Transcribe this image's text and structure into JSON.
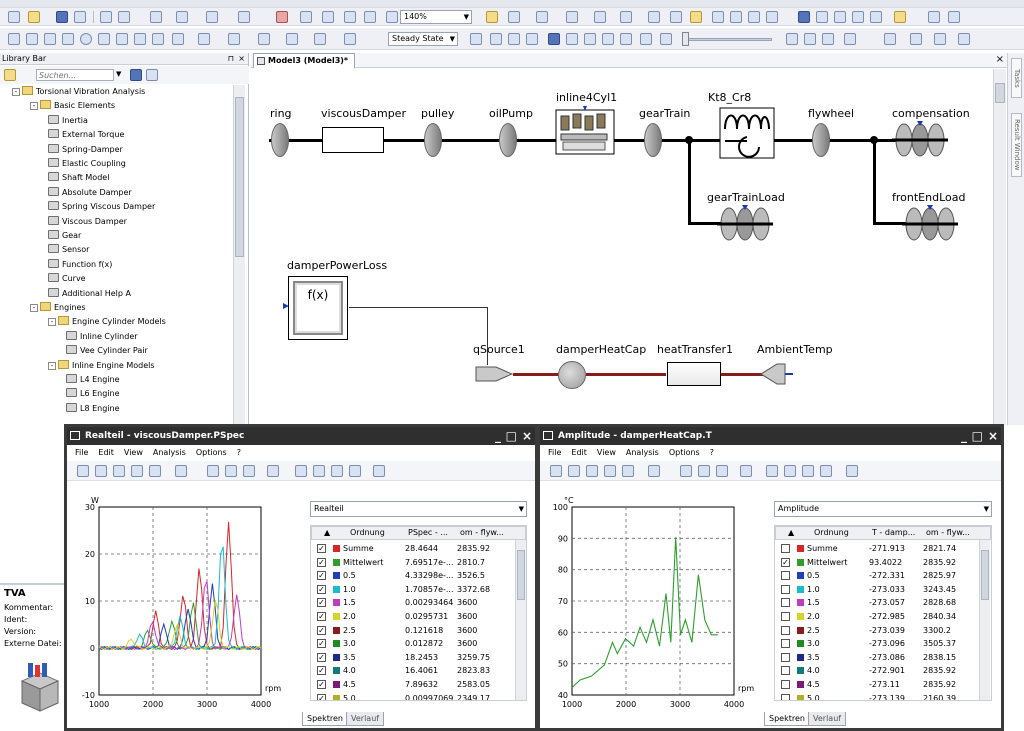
{
  "toolbar": {
    "zoom": "140%",
    "mode": "Steady State"
  },
  "library": {
    "title": "Library Bar",
    "search_placeholder": "Suchen...",
    "items": [
      {
        "label": "Torsional Vibration Analysis",
        "level": 0,
        "kind": "root"
      },
      {
        "label": "Basic Elements",
        "level": 1,
        "kind": "folder"
      },
      {
        "label": "Inertia",
        "level": 2,
        "kind": "item"
      },
      {
        "label": "External Torque",
        "level": 2,
        "kind": "item"
      },
      {
        "label": "Spring-Damper",
        "level": 2,
        "kind": "item"
      },
      {
        "label": "Elastic Coupling",
        "level": 2,
        "kind": "item"
      },
      {
        "label": "Shaft Model",
        "level": 2,
        "kind": "item"
      },
      {
        "label": "Absolute Damper",
        "level": 2,
        "kind": "item"
      },
      {
        "label": "Spring Viscous Damper",
        "level": 2,
        "kind": "item"
      },
      {
        "label": "Viscous Damper",
        "level": 2,
        "kind": "item"
      },
      {
        "label": "Gear",
        "level": 2,
        "kind": "item"
      },
      {
        "label": "Sensor",
        "level": 2,
        "kind": "item"
      },
      {
        "label": "Function f(x)",
        "level": 2,
        "kind": "item"
      },
      {
        "label": "Curve",
        "level": 2,
        "kind": "item"
      },
      {
        "label": "Additional Help A",
        "level": 2,
        "kind": "item"
      },
      {
        "label": "Engines",
        "level": 1,
        "kind": "folder"
      },
      {
        "label": "Engine Cylinder Models",
        "level": 2,
        "kind": "folder"
      },
      {
        "label": "Inline Cylinder",
        "level": 3,
        "kind": "item"
      },
      {
        "label": "Vee Cylinder Pair",
        "level": 3,
        "kind": "item"
      },
      {
        "label": "Inline Engine Models",
        "level": 2,
        "kind": "folder"
      },
      {
        "label": "L4 Engine",
        "level": 3,
        "kind": "item"
      },
      {
        "label": "L6 Engine",
        "level": 3,
        "kind": "item"
      },
      {
        "label": "L8 Engine",
        "level": 3,
        "kind": "item"
      }
    ]
  },
  "properties": {
    "title": "TVA",
    "fields": [
      "Kommentar:",
      "Ident:",
      "Version:",
      "Externe Datei:"
    ]
  },
  "model": {
    "tab": "Model3 (Model3)*",
    "labels": {
      "ring": "ring",
      "viscousDamper": "viscousDamper",
      "pulley": "pulley",
      "oilPump": "oilPump",
      "inline4Cyl1": "inline4Cyl1",
      "gearTrain": "gearTrain",
      "kt8": "Kt8_Cr8",
      "flywheel": "flywheel",
      "compensation": "compensation",
      "gearTrainLoad": "gearTrainLoad",
      "frontEndLoad": "frontEndLoad",
      "damperPowerLoss": "damperPowerLoss",
      "fx": "f(x)",
      "qSource1": "qSource1",
      "damperHeatCap": "damperHeatCap",
      "heatTransfer1": "heatTransfer1",
      "ambientTemp": "AmbientTemp"
    }
  },
  "side_tabs": {
    "tasks": "Tasks",
    "result": "Result Window"
  },
  "win1": {
    "title": "Realteil - viscousDamper.PSpec",
    "menu": [
      "File",
      "Edit",
      "View",
      "Analysis",
      "Options",
      "?"
    ],
    "combo": "Realteil",
    "headers": [
      "Ordnung",
      "PSpec - ...",
      "om - flyw..."
    ],
    "rows": [
      {
        "checked": true,
        "color": "#d62728",
        "name": "Summe",
        "v1": "28.4644",
        "v2": "2835.92"
      },
      {
        "checked": true,
        "color": "#2ca02c",
        "name": "Mittelwert",
        "v1": "7.69517e-...",
        "v2": "2810.7"
      },
      {
        "checked": true,
        "color": "#1f3fbf",
        "name": "0.5",
        "v1": "4.33298e-...",
        "v2": "3526.5"
      },
      {
        "checked": true,
        "color": "#17becf",
        "name": "1.0",
        "v1": "1.70857e-...",
        "v2": "3372.68"
      },
      {
        "checked": true,
        "color": "#c13cc1",
        "name": "1.5",
        "v1": "0.00293464",
        "v2": "3600"
      },
      {
        "checked": true,
        "color": "#d4d42a",
        "name": "2.0",
        "v1": "0.0295731",
        "v2": "3600"
      },
      {
        "checked": true,
        "color": "#8b1a1a",
        "name": "2.5",
        "v1": "0.121618",
        "v2": "3600"
      },
      {
        "checked": true,
        "color": "#1e8c1e",
        "name": "3.0",
        "v1": "0.012872",
        "v2": "3600"
      },
      {
        "checked": true,
        "color": "#1a2a8c",
        "name": "3.5",
        "v1": "18.2453",
        "v2": "3259.75"
      },
      {
        "checked": true,
        "color": "#117a7a",
        "name": "4.0",
        "v1": "16.4061",
        "v2": "2823.83"
      },
      {
        "checked": true,
        "color": "#7a1a7a",
        "name": "4.5",
        "v1": "7.89632",
        "v2": "2583.05"
      },
      {
        "checked": true,
        "color": "#b0b020",
        "name": "5.0",
        "v1": "0.00997069",
        "v2": "2349.17"
      }
    ],
    "tabs": [
      "Spektren",
      "Verlauf"
    ],
    "chart": {
      "ylabel": "W",
      "xlabel": "rpm",
      "xticks": [
        "1000",
        "2000",
        "3000",
        "4000"
      ],
      "yticks": [
        "30",
        "20",
        "10",
        "0",
        "-10"
      ]
    }
  },
  "win2": {
    "title": "Amplitude - damperHeatCap.T",
    "menu": [
      "File",
      "Edit",
      "View",
      "Analysis",
      "Options",
      "?"
    ],
    "combo": "Amplitude",
    "headers": [
      "Ordnung",
      "T - damp...",
      "om - flyw..."
    ],
    "rows": [
      {
        "checked": false,
        "color": "#d62728",
        "name": "Summe",
        "v1": "-271.913",
        "v2": "2821.74"
      },
      {
        "checked": true,
        "color": "#2ca02c",
        "name": "Mittelwert",
        "v1": "93.4022",
        "v2": "2835.92"
      },
      {
        "checked": false,
        "color": "#1f3fbf",
        "name": "0.5",
        "v1": "-272.331",
        "v2": "2825.97"
      },
      {
        "checked": false,
        "color": "#17becf",
        "name": "1.0",
        "v1": "-273.033",
        "v2": "3243.45"
      },
      {
        "checked": false,
        "color": "#c13cc1",
        "name": "1.5",
        "v1": "-273.057",
        "v2": "2828.68"
      },
      {
        "checked": false,
        "color": "#d4d42a",
        "name": "2.0",
        "v1": "-272.985",
        "v2": "2840.34"
      },
      {
        "checked": false,
        "color": "#8b1a1a",
        "name": "2.5",
        "v1": "-273.039",
        "v2": "3300.2"
      },
      {
        "checked": false,
        "color": "#1e8c1e",
        "name": "3.0",
        "v1": "-273.096",
        "v2": "3505.37"
      },
      {
        "checked": false,
        "color": "#1a2a8c",
        "name": "3.5",
        "v1": "-273.086",
        "v2": "2838.15"
      },
      {
        "checked": false,
        "color": "#117a7a",
        "name": "4.0",
        "v1": "-272.901",
        "v2": "2835.92"
      },
      {
        "checked": false,
        "color": "#7a1a7a",
        "name": "4.5",
        "v1": "-273.11",
        "v2": "2835.92"
      },
      {
        "checked": false,
        "color": "#b0b020",
        "name": "5.0",
        "v1": "-273.139",
        "v2": "2160.39"
      }
    ],
    "tabs": [
      "Spektren",
      "Verlauf"
    ],
    "chart": {
      "ylabel": "°C",
      "xlabel": "rpm",
      "xticks": [
        "1000",
        "2000",
        "3000",
        "4000"
      ],
      "yticks": [
        "100",
        "90",
        "80",
        "70",
        "60",
        "50",
        "40"
      ]
    }
  }
}
